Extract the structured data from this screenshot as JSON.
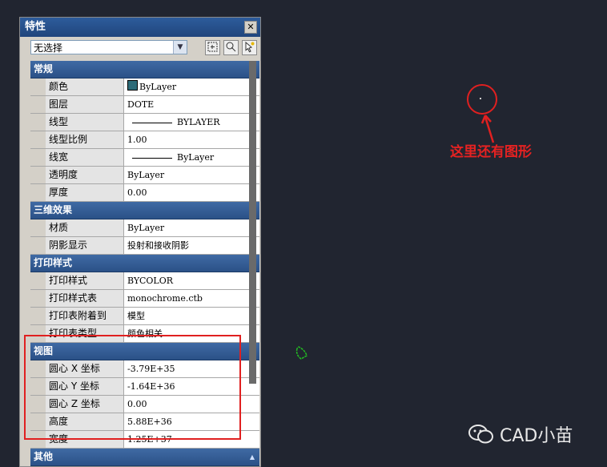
{
  "palette": {
    "title": "特性",
    "close": "✕",
    "selection": "无选择",
    "buttons": [
      "select-objects-icon",
      "quick-select-icon",
      "toggle-pickadd-icon"
    ],
    "sections": [
      {
        "title": "常规",
        "rows": [
          {
            "name": "颜色",
            "value": "ByLayer",
            "swatch": true
          },
          {
            "name": "图层",
            "value": "DOTE"
          },
          {
            "name": "线型",
            "value": "BYLAYER",
            "line": true
          },
          {
            "name": "线型比例",
            "value": "1.00"
          },
          {
            "name": "线宽",
            "value": "ByLayer",
            "line": true
          },
          {
            "name": "透明度",
            "value": "ByLayer"
          },
          {
            "name": "厚度",
            "value": "0.00"
          }
        ]
      },
      {
        "title": "三维效果",
        "rows": [
          {
            "name": "材质",
            "value": "ByLayer"
          },
          {
            "name": "阴影显示",
            "value": "投射和接收阴影"
          }
        ]
      },
      {
        "title": "打印样式",
        "rows": [
          {
            "name": "打印样式",
            "value": "BYCOLOR"
          },
          {
            "name": "打印样式表",
            "value": "monochrome.ctb"
          },
          {
            "name": "打印表附着到",
            "value": "模型"
          },
          {
            "name": "打印表类型",
            "value": "颜色相关"
          }
        ]
      },
      {
        "title": "视图",
        "rows": [
          {
            "name": "圆心 X 坐标",
            "value": "-3.79E+35"
          },
          {
            "name": "圆心 Y 坐标",
            "value": "-1.64E+36"
          },
          {
            "name": "圆心 Z 坐标",
            "value": "0.00"
          },
          {
            "name": "高度",
            "value": "5.88E+36"
          },
          {
            "name": "宽度",
            "value": "1.25E+37"
          }
        ]
      },
      {
        "title": "其他",
        "rows": []
      }
    ]
  },
  "canvas": {
    "annotation": "这里还有图形",
    "watermark": "CAD小苗",
    "colors": {
      "annotation": "#e52222",
      "highlight": "#e02020",
      "shape": "#22bb22",
      "background": "#212530"
    }
  }
}
